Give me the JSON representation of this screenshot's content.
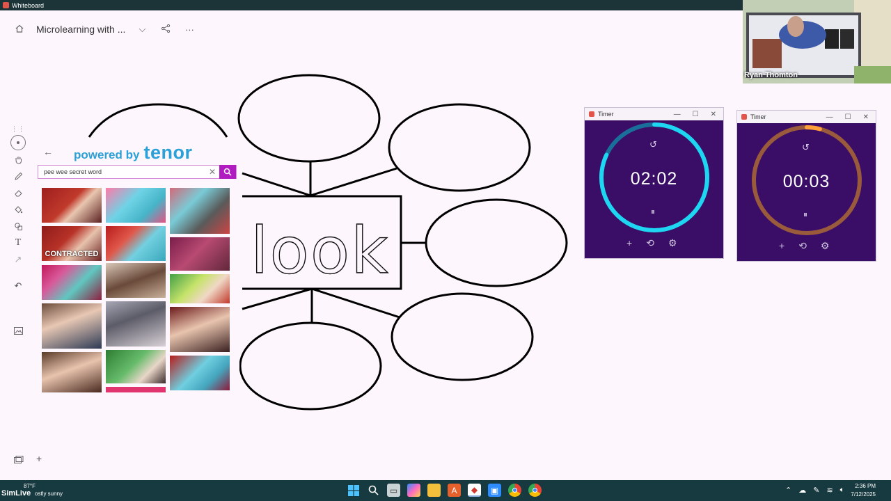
{
  "app": {
    "title": "Whiteboard"
  },
  "header": {
    "home_icon": "home-icon",
    "board_title": "Microlearning with ...",
    "chevron": "⌵",
    "share_icon": "share-icon",
    "more": "···"
  },
  "tools": [
    "select-icon",
    "hand-icon",
    "pen-icon",
    "eraser-icon",
    "fill-icon",
    "shapes-icon",
    "text-icon",
    "laser-icon",
    "undo-icon",
    "image-icon"
  ],
  "tenor": {
    "brand_small": "powered by",
    "brand_big": "tenor",
    "search_value": "pee wee secret word",
    "gif_captions": {
      "g4": "CONTRACTED"
    },
    "colors": {
      "brand": "#2aa1d8",
      "search_button": "#b11cc0"
    }
  },
  "board": {
    "center_word": "look"
  },
  "timers": [
    {
      "title": "Timer",
      "time": "02:02",
      "progress": 0.82,
      "ring_color": "#1fd6f2"
    },
    {
      "title": "Timer",
      "time": "00:03",
      "progress": 0.04,
      "ring_color": "#ff9f3a"
    }
  ],
  "camera": {
    "name": "Ryan Thomton"
  },
  "taskbar": {
    "weather_temp": "87°F",
    "weather_text": "ostly sunny",
    "overlay_brand": "SimLive",
    "time": "2:36 PM",
    "date": "7/12/2025"
  }
}
